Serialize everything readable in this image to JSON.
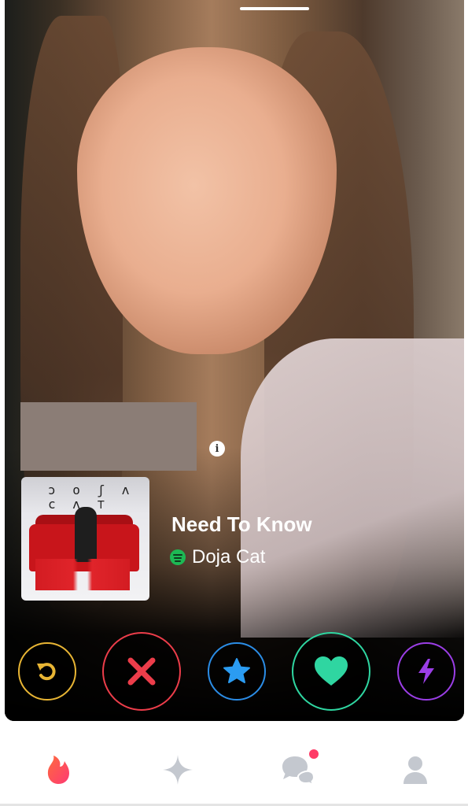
{
  "card": {
    "anthem": {
      "song_title": "Need To Know",
      "artist": "Doja Cat",
      "source_icon": "spotify-icon",
      "album_art_text": "DOJA CAT"
    },
    "info_icon_glyph": "i"
  },
  "actions": [
    {
      "name": "rewind-button",
      "icon": "rewind-icon",
      "color": "#e8b534"
    },
    {
      "name": "nope-button",
      "icon": "x-icon",
      "color": "#ec3d4a"
    },
    {
      "name": "super-like-button",
      "icon": "star-icon",
      "color": "#2b8de6"
    },
    {
      "name": "like-button",
      "icon": "heart-icon",
      "color": "#2fd6a1"
    },
    {
      "name": "boost-button",
      "icon": "lightning-icon",
      "color": "#9b3ee6"
    }
  ],
  "nav": {
    "items": [
      {
        "name": "swipe",
        "icon": "flame-icon",
        "active": true
      },
      {
        "name": "explore",
        "icon": "sparkle-icon"
      },
      {
        "name": "messages",
        "icon": "chat-bubbles-icon",
        "notification": true
      },
      {
        "name": "profile",
        "icon": "person-icon"
      }
    ]
  },
  "colors": {
    "brand": "#fd4a66",
    "rewind": "#e8b534",
    "nope": "#ec3d4a",
    "super_like": "#2b8de6",
    "like": "#2fd6a1",
    "boost": "#9b3ee6",
    "spotify": "#1db954"
  }
}
